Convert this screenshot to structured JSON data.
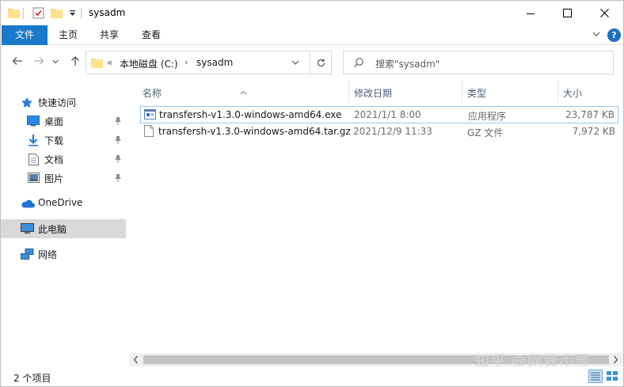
{
  "window": {
    "title": "sysadm"
  },
  "ribbon": {
    "tabs": [
      {
        "label": "文件",
        "active": true
      },
      {
        "label": "主页"
      },
      {
        "label": "共享"
      },
      {
        "label": "查看"
      }
    ],
    "help_label": "?"
  },
  "address": {
    "overflow": "«",
    "crumbs": [
      "本地磁盘 (C:)",
      "sysadm"
    ],
    "separator": "›"
  },
  "search": {
    "placeholder": "搜索\"sysadm\""
  },
  "sidebar": {
    "items": [
      {
        "label": "快速访问",
        "icon": "star-icon"
      },
      {
        "label": "桌面",
        "icon": "desktop-icon",
        "pinned": true
      },
      {
        "label": "下载",
        "icon": "download-icon",
        "pinned": true
      },
      {
        "label": "文档",
        "icon": "document-icon",
        "pinned": true
      },
      {
        "label": "图片",
        "icon": "picture-icon",
        "pinned": true
      },
      {
        "label": "OneDrive",
        "icon": "cloud-icon"
      },
      {
        "label": "此电脑",
        "icon": "computer-icon",
        "selected": true
      },
      {
        "label": "网络",
        "icon": "network-icon"
      }
    ]
  },
  "columns": {
    "name": "名称",
    "date": "修改日期",
    "type": "类型",
    "size": "大小"
  },
  "files": [
    {
      "name": "transfersh-v1.3.0-windows-amd64.exe",
      "date": "2021/1/1 8:00",
      "type": "应用程序",
      "size": "23,787 KB",
      "icon": "exe-icon",
      "selected": true
    },
    {
      "name": "transfersh-v1.3.0-windows-amd64.tar.gz",
      "date": "2021/12/9 11:33",
      "type": "GZ 文件",
      "size": "7,972 KB",
      "icon": "file-icon"
    }
  ],
  "status": {
    "item_count": "2 个项目"
  },
  "watermark": "知乎 @网管小贾",
  "colors": {
    "accent": "#1979ca",
    "selection_border": "#99c9ef",
    "sidebar_selected": "#d9d9d9"
  }
}
